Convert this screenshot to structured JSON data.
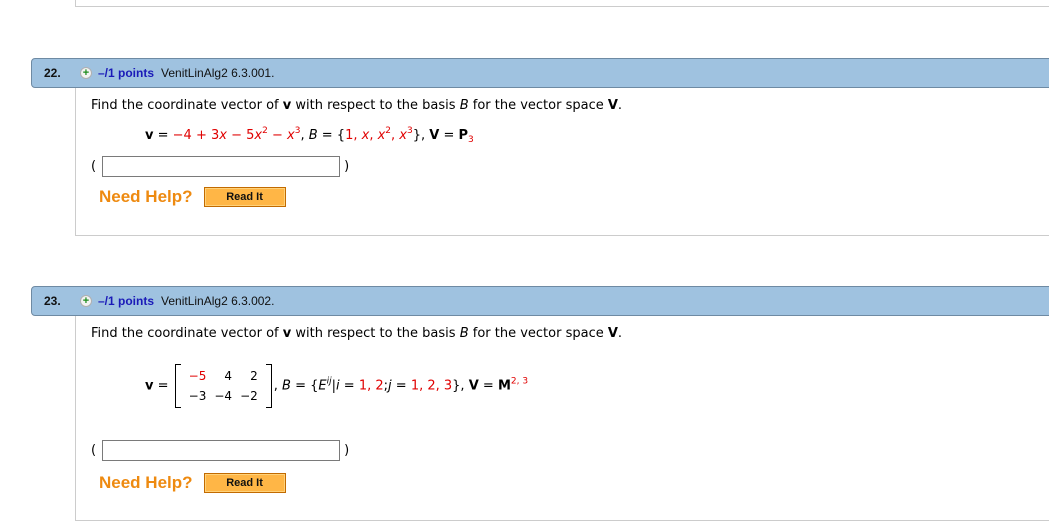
{
  "questions": [
    {
      "number": "22.",
      "points": "–/1 points",
      "id": "VenitLinAlg2 6.3.001.",
      "prompt_pre": "Find the coordinate vector of ",
      "prompt_v": "v",
      "prompt_mid": " with respect to the basis ",
      "prompt_B": "B",
      "prompt_mid2": " for the vector space ",
      "prompt_V": "V",
      "prompt_end": ".",
      "math": {
        "v_label": "v",
        "eq": " = ",
        "poly": [
          "−4 + 3",
          "x",
          " − 5",
          "x",
          "2",
          " − ",
          "x",
          "3"
        ],
        "B_label": "B",
        "basis": [
          "1, ",
          "x",
          ", ",
          "x",
          "2",
          ", ",
          "x",
          "3"
        ],
        "V_label": "V",
        "space": "P",
        "space_sub": "3"
      },
      "answer": {
        "open": "(",
        "close": ")",
        "value": ""
      },
      "help": {
        "label": "Need Help?",
        "button": "Read It"
      }
    },
    {
      "number": "23.",
      "points": "–/1 points",
      "id": "VenitLinAlg2 6.3.002.",
      "prompt_pre": "Find the coordinate vector of ",
      "prompt_v": "v",
      "prompt_mid": " with respect to the basis ",
      "prompt_B": "B",
      "prompt_mid2": " for the vector space ",
      "prompt_V": "V",
      "prompt_end": ".",
      "math": {
        "v_label": "v",
        "eq": " = ",
        "matrix": [
          [
            "−5",
            "4",
            "2"
          ],
          [
            "−3",
            "−4",
            "−2"
          ]
        ],
        "B_label": "B",
        "basis_E": "E",
        "basis_E_sup": "ij",
        "i_label": "i",
        "i_vals": "1, 2",
        "j_label": "j",
        "j_vals": "1, 2, 3",
        "V_label": "V",
        "space": "M",
        "space_sup": "2, 3"
      },
      "answer": {
        "open": "(",
        "close": ")",
        "value": ""
      },
      "help": {
        "label": "Need Help?",
        "button": "Read It"
      }
    }
  ]
}
